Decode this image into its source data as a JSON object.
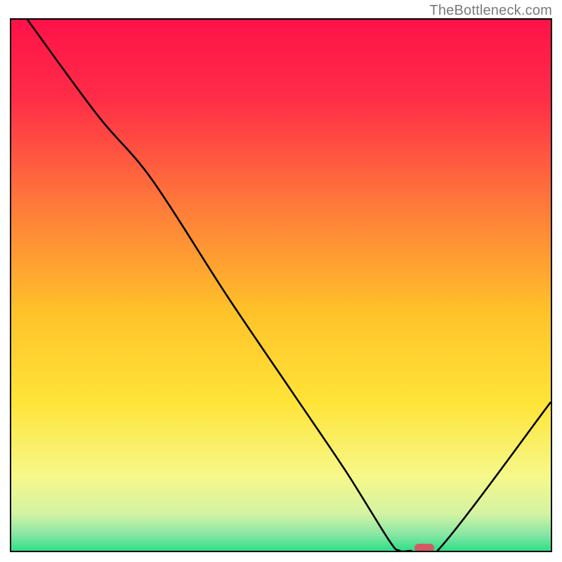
{
  "watermark": "TheBottleneck.com",
  "chart_data": {
    "type": "line",
    "title": "",
    "xlabel": "",
    "ylabel": "",
    "xlim": [
      0,
      100
    ],
    "ylim": [
      0,
      100
    ],
    "series": [
      {
        "name": "curve",
        "x": [
          3,
          16,
          26,
          40,
          52,
          62,
          70,
          72,
          74,
          79,
          100
        ],
        "y": [
          100,
          82,
          70,
          48,
          30,
          15,
          2,
          0,
          0,
          0,
          28
        ]
      }
    ],
    "marker": {
      "x": 76.5,
      "y": 0.5,
      "color": "#d35a62"
    },
    "gradient_stops": [
      {
        "offset": 0,
        "color": "#ff1249"
      },
      {
        "offset": 15,
        "color": "#ff2d47"
      },
      {
        "offset": 35,
        "color": "#ff7a3a"
      },
      {
        "offset": 55,
        "color": "#ffc22a"
      },
      {
        "offset": 72,
        "color": "#ffe438"
      },
      {
        "offset": 86,
        "color": "#f6f88a"
      },
      {
        "offset": 93,
        "color": "#d4f3a2"
      },
      {
        "offset": 97,
        "color": "#86e6a4"
      },
      {
        "offset": 100,
        "color": "#2fde87"
      }
    ],
    "curve_style": {
      "stroke": "#000000",
      "width": 2.6
    }
  }
}
